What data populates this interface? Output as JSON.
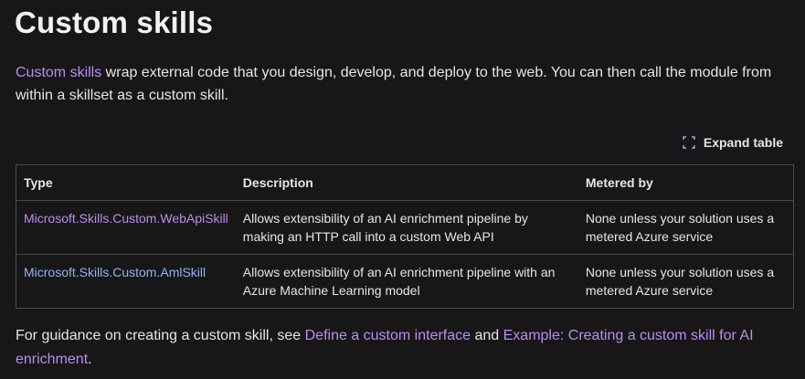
{
  "page": {
    "title": "Custom skills",
    "intro": {
      "link_text": "Custom skills",
      "text": " wrap external code that you design, develop, and deploy to the web. You can then call the module from within a skillset as a custom skill."
    },
    "expand_label": "Expand table",
    "table": {
      "headers": [
        "Type",
        "Description",
        "Metered by"
      ],
      "rows": [
        {
          "type": "Microsoft.Skills.Custom.WebApiSkill",
          "description": "Allows extensibility of an AI enrichment pipeline by making an HTTP call into a custom Web API",
          "metered_by": "None unless your solution uses a metered Azure service"
        },
        {
          "type": "Microsoft.Skills.Custom.AmlSkill",
          "description": "Allows extensibility of an AI enrichment pipeline with an Azure Machine Learning model",
          "metered_by": "None unless your solution uses a metered Azure service"
        }
      ]
    },
    "footer": {
      "prefix": "For guidance on creating a custom skill, see ",
      "link1": "Define a custom interface",
      "middle": " and ",
      "link2": "Example: Creating a custom skill for AI enrichment",
      "suffix": "."
    }
  },
  "colors": {
    "background": "#171717",
    "link_purple": "#b88ef0",
    "link_blue": "#8fb3f5",
    "border": "#4a4a4a"
  },
  "icons": {
    "expand": "expand-icon"
  }
}
